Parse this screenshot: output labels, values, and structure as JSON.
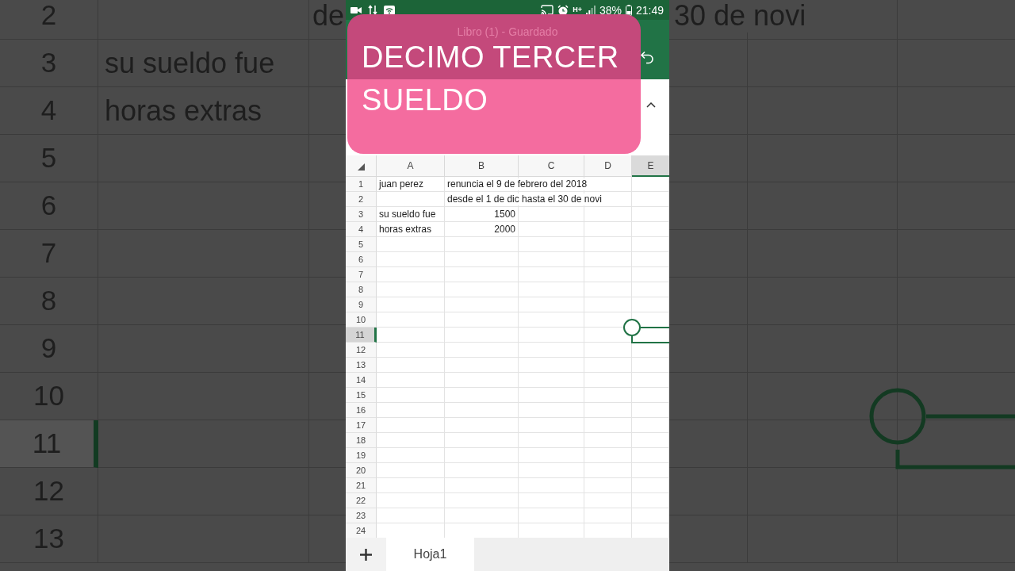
{
  "status_bar": {
    "network": "H+",
    "battery": "38%",
    "time": "21:49"
  },
  "title_bar": {
    "title": "Libro (1) - Guardado"
  },
  "caption": {
    "lines": [
      "DECIMO TERCER",
      "SUELDO"
    ]
  },
  "sheet": {
    "columns": [
      {
        "label": "A",
        "selected": false
      },
      {
        "label": "B",
        "selected": false
      },
      {
        "label": "C",
        "selected": false
      },
      {
        "label": "D",
        "selected": false
      },
      {
        "label": "E",
        "selected": true
      }
    ],
    "rows": [
      {
        "number": "1",
        "selected": false,
        "cells": [
          {
            "kind": "text",
            "text": "juan perez"
          },
          {
            "kind": "text",
            "text": "renuncia el 9 de febrero del 2018"
          }
        ]
      },
      {
        "number": "2",
        "selected": false,
        "cells": [
          {
            "kind": "empty"
          },
          {
            "kind": "text",
            "text": "desde el 1 de dic hasta el 30 de novi"
          }
        ]
      },
      {
        "number": "3",
        "selected": false,
        "cells": [
          {
            "kind": "text",
            "text": "su sueldo fue"
          },
          {
            "kind": "number",
            "text": "1500"
          }
        ]
      },
      {
        "number": "4",
        "selected": false,
        "cells": [
          {
            "kind": "text",
            "text": "horas extras"
          },
          {
            "kind": "number",
            "text": "2000"
          }
        ]
      },
      {
        "number": "5",
        "selected": false
      },
      {
        "number": "6",
        "selected": false
      },
      {
        "number": "7",
        "selected": false
      },
      {
        "number": "8",
        "selected": false
      },
      {
        "number": "9",
        "selected": false
      },
      {
        "number": "10",
        "selected": false
      },
      {
        "number": "11",
        "selected": true
      },
      {
        "number": "12",
        "selected": false
      },
      {
        "number": "13",
        "selected": false
      },
      {
        "number": "14",
        "selected": false
      },
      {
        "number": "15",
        "selected": false
      },
      {
        "number": "16",
        "selected": false
      },
      {
        "number": "17",
        "selected": false
      },
      {
        "number": "18",
        "selected": false
      },
      {
        "number": "19",
        "selected": false
      },
      {
        "number": "20",
        "selected": false
      },
      {
        "number": "21",
        "selected": false
      },
      {
        "number": "22",
        "selected": false
      },
      {
        "number": "23",
        "selected": false
      },
      {
        "number": "24",
        "selected": false
      }
    ]
  },
  "sheet_tabs": [
    {
      "label": "Hoja1",
      "selected": true
    }
  ],
  "backdrop": {
    "rows": [
      {
        "number": "2",
        "selected": false,
        "cells": [
          {
            "kind": "empty"
          },
          {
            "kind": "text",
            "text": "de"
          }
        ],
        "right_text": "30 de novi"
      },
      {
        "number": "3",
        "selected": false,
        "cells": [
          {
            "kind": "text",
            "text": "su sueldo fue"
          }
        ]
      },
      {
        "number": "4",
        "selected": false,
        "cells": [
          {
            "kind": "text",
            "text": "horas extras"
          }
        ]
      },
      {
        "number": "5",
        "selected": false
      },
      {
        "number": "6",
        "selected": false
      },
      {
        "number": "7",
        "selected": false
      },
      {
        "number": "8",
        "selected": false
      },
      {
        "number": "9",
        "selected": false
      },
      {
        "number": "10",
        "selected": false
      },
      {
        "number": "11",
        "selected": true
      },
      {
        "number": "12",
        "selected": false
      },
      {
        "number": "13",
        "selected": false
      }
    ]
  }
}
